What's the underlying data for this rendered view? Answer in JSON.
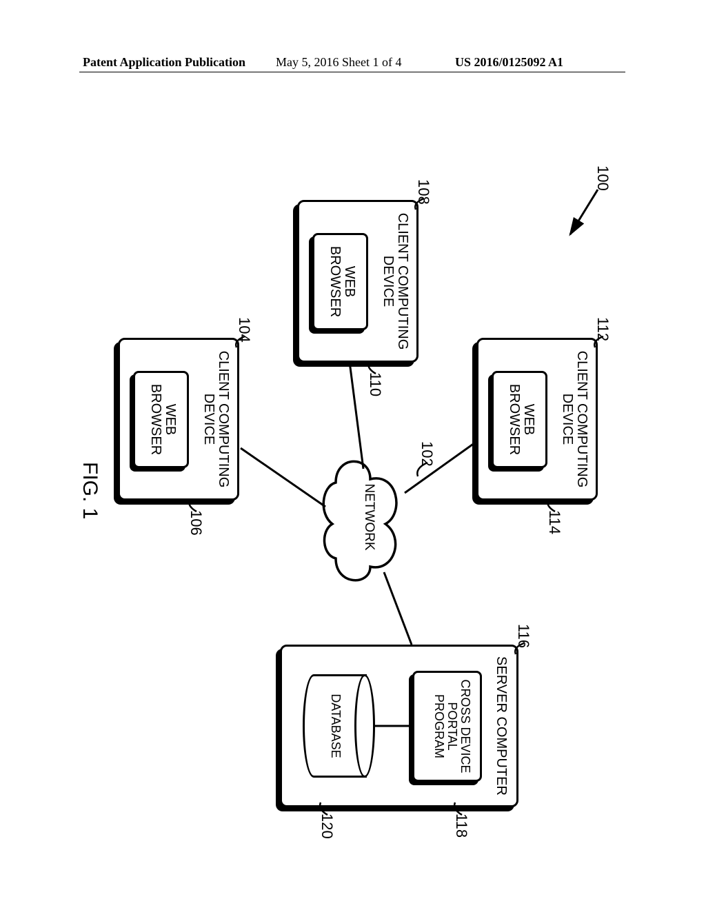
{
  "header": {
    "left": "Patent Application Publication",
    "mid": "May 5, 2016  Sheet 1 of 4",
    "right": "US 2016/0125092 A1"
  },
  "figure": {
    "caption": "FIG. 1",
    "system_ref": "100",
    "network": {
      "label": "NETWORK",
      "ref": "102"
    },
    "client_a": {
      "title": "CLIENT COMPUTING\nDEVICE",
      "ref": "104",
      "browser": {
        "label": "WEB\nBROWSER",
        "ref": "106"
      }
    },
    "client_b": {
      "title": "CLIENT COMPUTING\nDEVICE",
      "ref": "108",
      "browser": {
        "label": "WEB\nBROWSER",
        "ref": "110"
      }
    },
    "client_c": {
      "title": "CLIENT COMPUTING\nDEVICE",
      "ref": "112",
      "browser": {
        "label": "WEB\nBROWSER",
        "ref": "114"
      }
    },
    "server": {
      "title": "SERVER COMPUTER",
      "ref": "116",
      "program": {
        "label": "CROSS DEVICE\nPORTAL\nPROGRAM",
        "ref": "118"
      },
      "database": {
        "label": "DATABASE",
        "ref": "120"
      }
    }
  }
}
